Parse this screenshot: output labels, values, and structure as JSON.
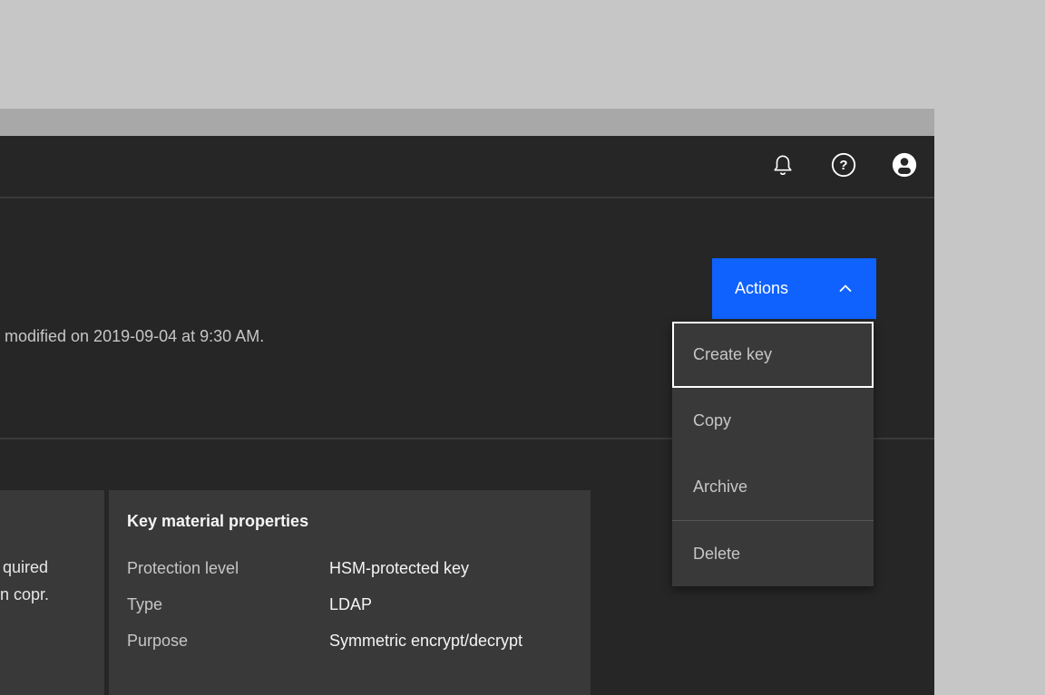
{
  "colors": {
    "desktop_bg": "#c6c6c6",
    "titlebar": "#a8a8a8",
    "surface": "#262626",
    "layer": "#393939",
    "accent_blue": "#0f62fe",
    "text_primary": "#f4f4f4",
    "text_secondary": "#c6c6c6"
  },
  "header": {
    "icons": [
      {
        "name": "notification-bell"
      },
      {
        "name": "help"
      },
      {
        "name": "user-avatar"
      }
    ]
  },
  "page_header": {
    "modified_text": "modified on 2019-09-04 at 9:30 AM."
  },
  "actions": {
    "button_label": "Actions",
    "menu_items": [
      {
        "label": "Create key",
        "focused": true
      },
      {
        "label": "Copy",
        "focused": false
      },
      {
        "label": "Archive",
        "focused": false
      },
      {
        "label": "Delete",
        "focused": false,
        "divider_above": true
      }
    ]
  },
  "left_card": {
    "line_fragments": [
      "quired",
      "n copr."
    ]
  },
  "key_material": {
    "title": "Key material properties",
    "rows": [
      {
        "label": "Protection level",
        "value": "HSM-protected key"
      },
      {
        "label": "Type",
        "value": "LDAP"
      },
      {
        "label": "Purpose",
        "value": "Symmetric encrypt/decrypt"
      }
    ]
  }
}
